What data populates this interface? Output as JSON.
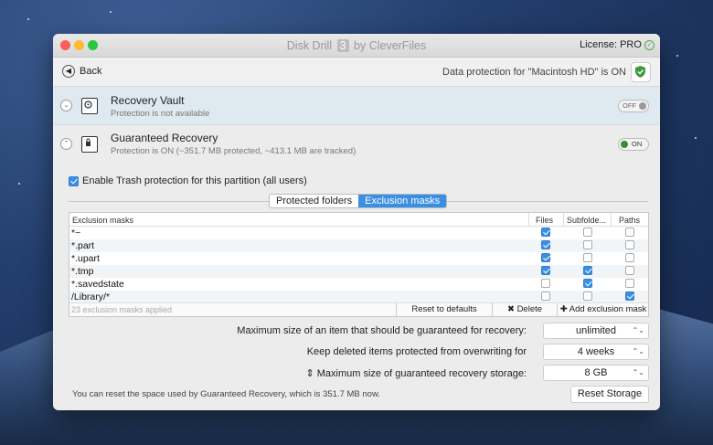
{
  "window": {
    "app_name": "Disk Drill",
    "version": "3",
    "vendor": "by CleverFiles",
    "license": "License: PRO"
  },
  "toolbar": {
    "back_label": "Back",
    "protection_status": "Data protection for \"Macintosh HD\" is ON"
  },
  "recovery_vault": {
    "title": "Recovery Vault",
    "subtitle": "Protection is not available",
    "toggle": "OFF"
  },
  "guaranteed_recovery": {
    "title": "Guaranteed Recovery",
    "subtitle": "Protection is ON (~351.7 MB protected, ~413.1 MB are tracked)",
    "toggle": "ON"
  },
  "trash_protection": {
    "label": "Enable Trash protection for this partition (all users)",
    "checked": true
  },
  "tabs": [
    {
      "label": "Protected folders",
      "selected": false
    },
    {
      "label": "Exclusion masks",
      "selected": true
    }
  ],
  "table": {
    "headers": [
      "Exclusion masks",
      "Files",
      "Subfolde...",
      "Paths"
    ],
    "rows": [
      {
        "mask": "*~",
        "files": true,
        "subfolders": false,
        "paths": false
      },
      {
        "mask": "*.part",
        "files": true,
        "subfolders": false,
        "paths": false
      },
      {
        "mask": "*.upart",
        "files": true,
        "subfolders": false,
        "paths": false
      },
      {
        "mask": "*.tmp",
        "files": true,
        "subfolders": true,
        "paths": false
      },
      {
        "mask": "*.savedstate",
        "files": false,
        "subfolders": true,
        "paths": false
      },
      {
        "mask": "/Library/*",
        "files": false,
        "subfolders": false,
        "paths": true
      }
    ],
    "footer_count": "23 exclusion masks applied",
    "reset_label": "Reset to defaults",
    "delete_label": "Delete",
    "add_label": "Add exclusion mask"
  },
  "settings": [
    {
      "label": "Maximum size of an item that should be guaranteed for recovery:",
      "value": "unlimited"
    },
    {
      "label": "Keep deleted items protected from overwriting for",
      "value": "4 weeks"
    },
    {
      "label": "Maximum size of guaranteed recovery storage:",
      "value": "8 GB"
    }
  ],
  "footer": {
    "note": "You can reset the space used by Guaranteed Recovery, which is 351.7 MB now.",
    "reset_storage": "Reset Storage"
  },
  "colors": {
    "accent": "#3b8fe3",
    "on_green": "#3f8a3a",
    "close": "#fc5f57",
    "minimize": "#fdbc2e",
    "zoom": "#28c840"
  }
}
